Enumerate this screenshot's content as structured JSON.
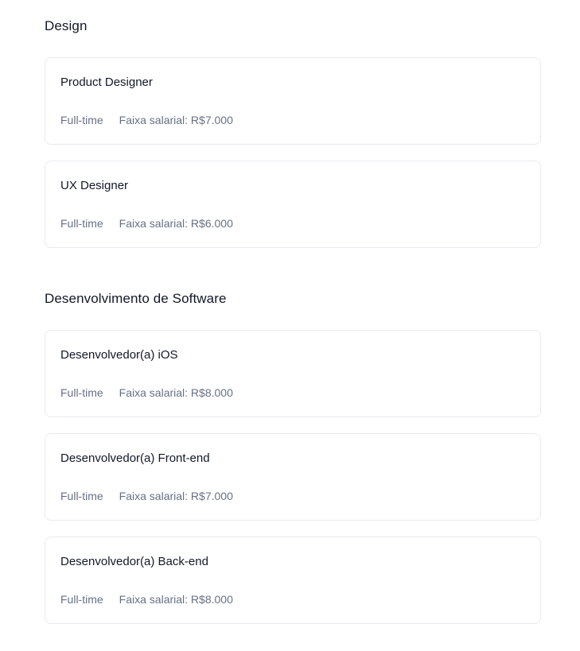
{
  "sections": [
    {
      "title": "Design",
      "jobs": [
        {
          "title": "Product Designer",
          "type": "Full-time",
          "salary": "Faixa salarial: R$7.000"
        },
        {
          "title": "UX Designer",
          "type": "Full-time",
          "salary": "Faixa salarial: R$6.000"
        }
      ]
    },
    {
      "title": "Desenvolvimento de Software",
      "jobs": [
        {
          "title": "Desenvolvedor(a) iOS",
          "type": "Full-time",
          "salary": "Faixa salarial: R$8.000"
        },
        {
          "title": "Desenvolvedor(a) Front-end",
          "type": "Full-time",
          "salary": "Faixa salarial: R$7.000"
        },
        {
          "title": "Desenvolvedor(a) Back-end",
          "type": "Full-time",
          "salary": "Faixa salarial: R$8.000"
        }
      ]
    }
  ]
}
